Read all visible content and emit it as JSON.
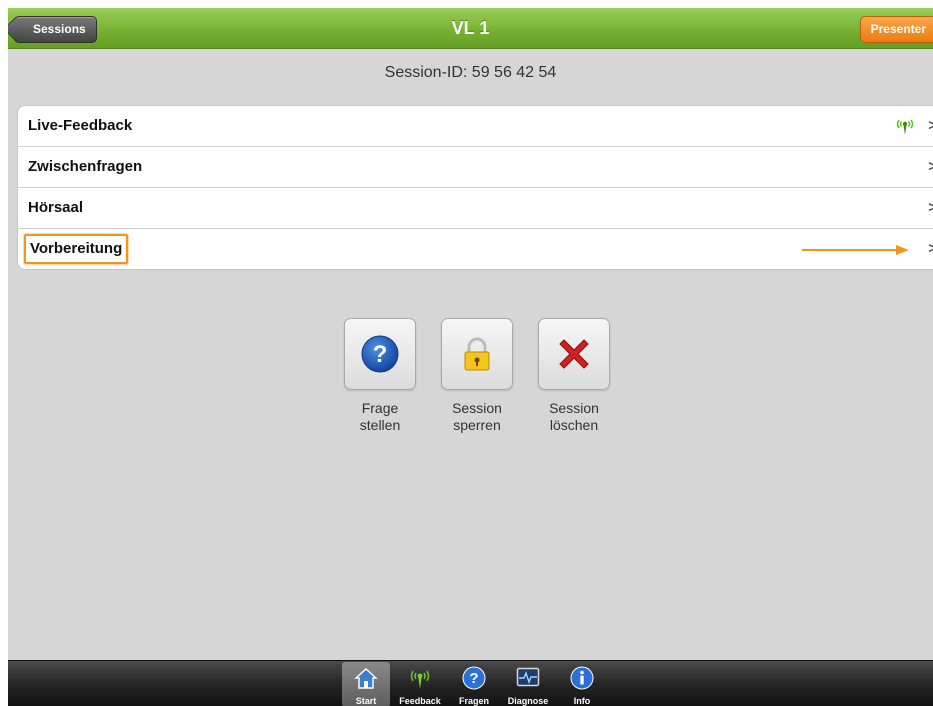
{
  "header": {
    "back_label": "Sessions",
    "title": "VL 1",
    "presenter_label": "Presenter"
  },
  "session_id_text": "Session-ID: 59 56 42 54",
  "menu": {
    "items": [
      {
        "label": "Live-Feedback",
        "icon": "antenna-icon"
      },
      {
        "label": "Zwischenfragen"
      },
      {
        "label": "Hörsaal"
      },
      {
        "label": "Vorbereitung",
        "highlighted": true
      }
    ],
    "chevron": ">"
  },
  "actions": [
    {
      "line1": "Frage",
      "line2": "stellen",
      "icon": "question-icon"
    },
    {
      "line1": "Session",
      "line2": "sperren",
      "icon": "lock-icon"
    },
    {
      "line1": "Session",
      "line2": "löschen",
      "icon": "delete-icon"
    }
  ],
  "tabbar": {
    "tabs": [
      {
        "label": "Start",
        "icon": "home-icon",
        "active": true
      },
      {
        "label": "Feedback",
        "icon": "antenna-icon"
      },
      {
        "label": "Fragen",
        "icon": "question-icon"
      },
      {
        "label": "Diagnose",
        "icon": "monitor-icon"
      },
      {
        "label": "Info",
        "icon": "info-icon"
      }
    ]
  },
  "colors": {
    "header_green": "#78b233",
    "presenter_orange": "#ec7c10",
    "highlight_orange": "#f0961e",
    "background": "#d6d6d6"
  }
}
